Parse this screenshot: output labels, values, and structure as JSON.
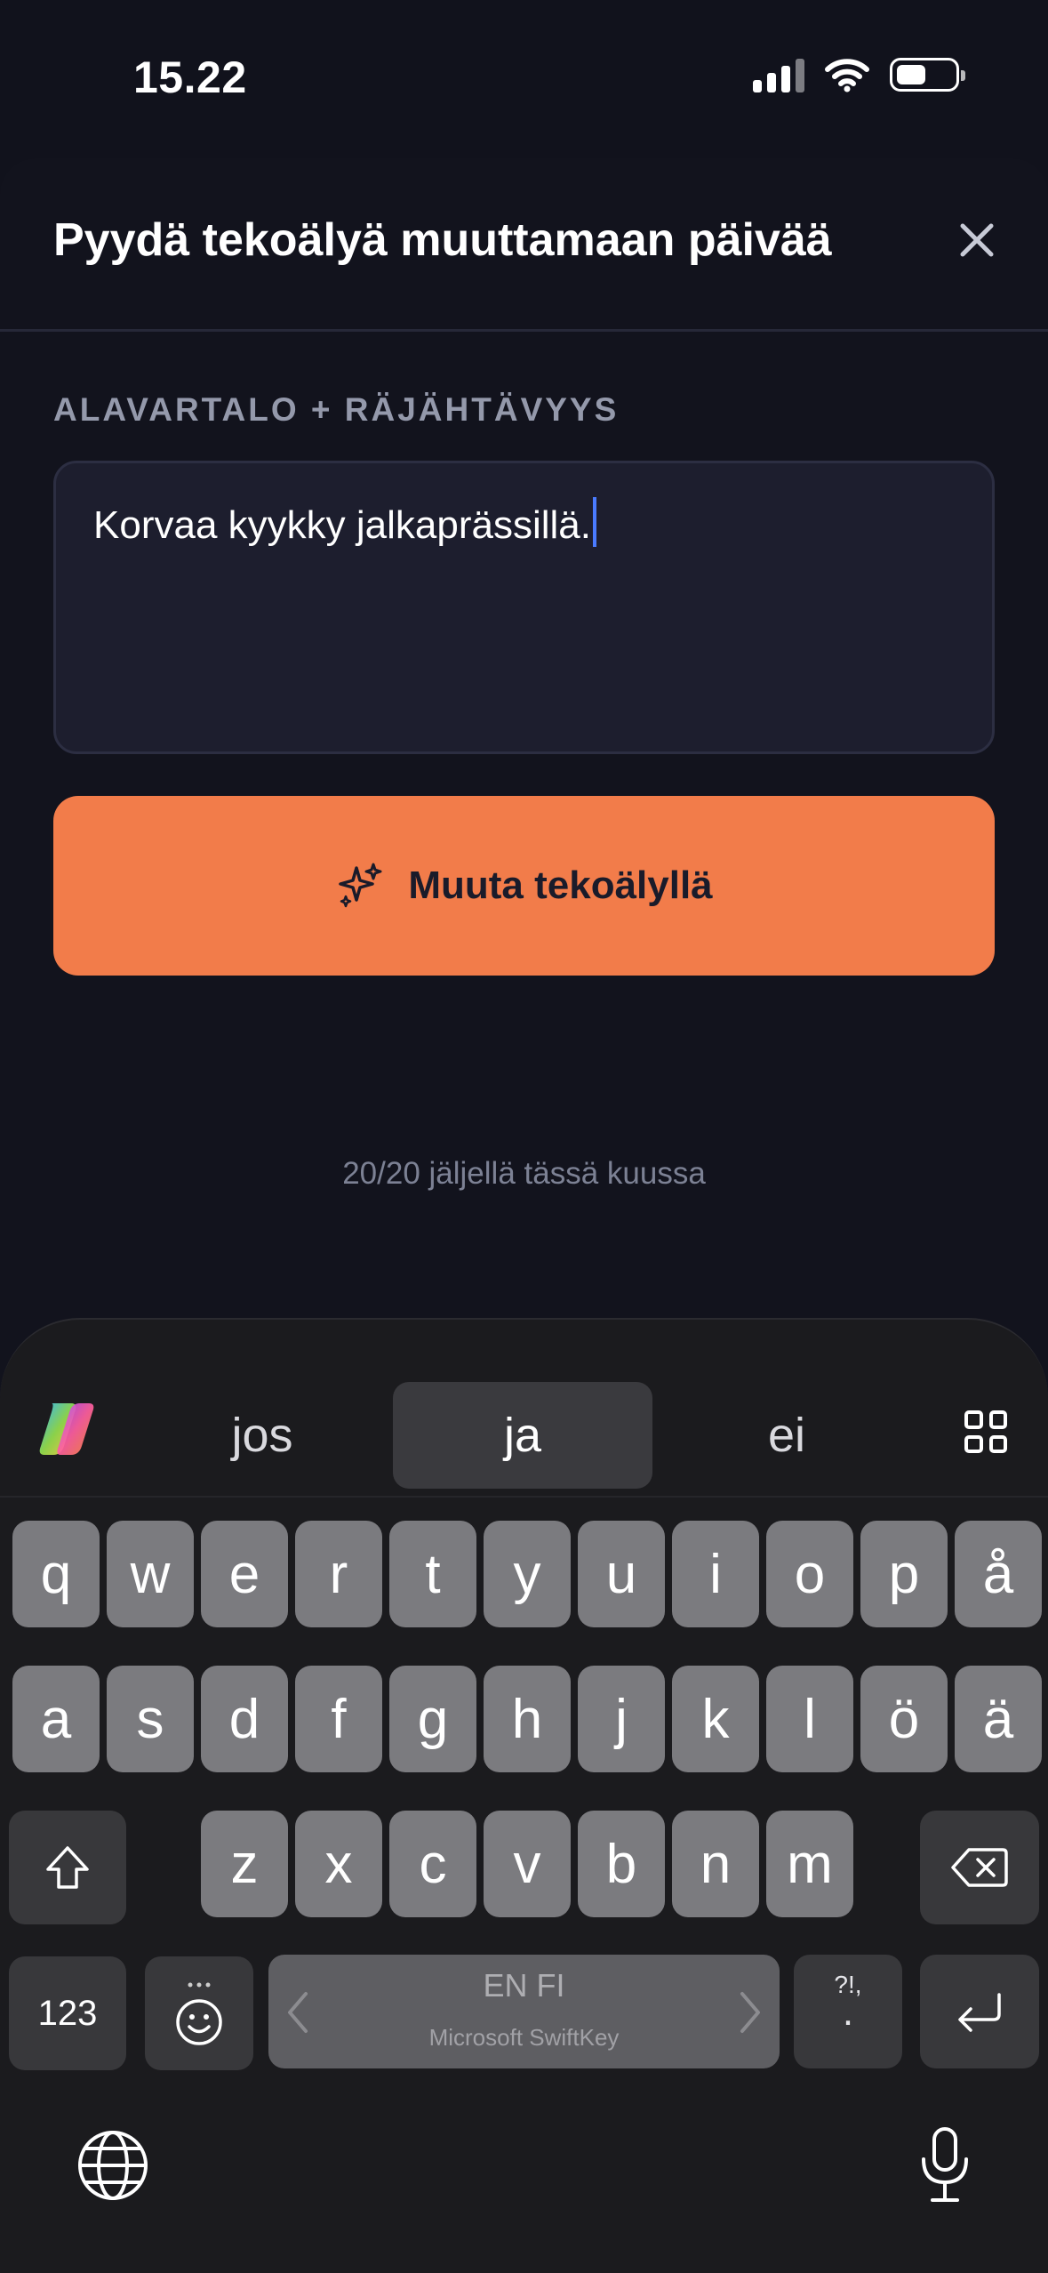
{
  "status_bar": {
    "time": "15.22"
  },
  "sheet": {
    "title": "Pyydä tekoälyä muuttamaan päivää",
    "section_label": "ALAVARTALO + RÄJÄHTÄVYYS",
    "input_value": "Korvaa kyykky jalkaprässillä.",
    "ai_button_label": "Muuta tekoälyllä",
    "quota_text": "20/20 jäljellä tässä kuussa",
    "accent_color": "#f27c4a"
  },
  "keyboard": {
    "suggestions": [
      "jos",
      "ja",
      "ei"
    ],
    "row1": [
      "q",
      "w",
      "e",
      "r",
      "t",
      "y",
      "u",
      "i",
      "o",
      "p",
      "å"
    ],
    "row2": [
      "a",
      "s",
      "d",
      "f",
      "g",
      "h",
      "j",
      "k",
      "l",
      "ö",
      "ä"
    ],
    "row3": [
      "z",
      "x",
      "c",
      "v",
      "b",
      "n",
      "m"
    ],
    "numbers_label": "123",
    "space_language": "EN FI",
    "space_brand": "Microsoft SwiftKey",
    "punct_top": "?!,",
    "punct_bottom": ".",
    "icons": [
      "copilot-icon",
      "grid-icon",
      "shift-icon",
      "backspace-icon",
      "emoji-icon",
      "return-icon",
      "globe-icon",
      "microphone-icon"
    ]
  }
}
